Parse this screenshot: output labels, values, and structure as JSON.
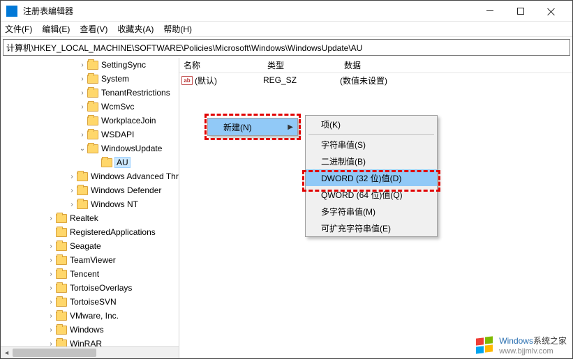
{
  "window": {
    "title": "注册表编辑器",
    "minimize": "—",
    "maximize": "□",
    "close": "×"
  },
  "menubar": [
    "文件(F)",
    "编辑(E)",
    "查看(V)",
    "收藏夹(A)",
    "帮助(H)"
  ],
  "address": "计算机\\HKEY_LOCAL_MACHINE\\SOFTWARE\\Policies\\Microsoft\\Windows\\WindowsUpdate\\AU",
  "columns": {
    "name": "名称",
    "type": "类型",
    "data": "数据"
  },
  "tree": [
    {
      "indent": 110,
      "chev": ">",
      "label": "SettingSync"
    },
    {
      "indent": 110,
      "chev": ">",
      "label": "System"
    },
    {
      "indent": 110,
      "chev": ">",
      "label": "TenantRestrictions"
    },
    {
      "indent": 110,
      "chev": ">",
      "label": "WcmSvc"
    },
    {
      "indent": 110,
      "chev": "",
      "label": "WorkplaceJoin"
    },
    {
      "indent": 110,
      "chev": ">",
      "label": "WSDAPI"
    },
    {
      "indent": 110,
      "chev": "v",
      "label": "WindowsUpdate"
    },
    {
      "indent": 130,
      "chev": "",
      "label": "AU",
      "highlight": true
    },
    {
      "indent": 95,
      "chev": ">",
      "label": "Windows Advanced Threat Protection"
    },
    {
      "indent": 95,
      "chev": ">",
      "label": "Windows Defender"
    },
    {
      "indent": 95,
      "chev": ">",
      "label": "Windows NT"
    },
    {
      "indent": 65,
      "chev": ">",
      "label": "Realtek"
    },
    {
      "indent": 65,
      "chev": "",
      "label": "RegisteredApplications"
    },
    {
      "indent": 65,
      "chev": ">",
      "label": "Seagate"
    },
    {
      "indent": 65,
      "chev": ">",
      "label": "TeamViewer"
    },
    {
      "indent": 65,
      "chev": ">",
      "label": "Tencent"
    },
    {
      "indent": 65,
      "chev": ">",
      "label": "TortoiseOverlays"
    },
    {
      "indent": 65,
      "chev": ">",
      "label": "TortoiseSVN"
    },
    {
      "indent": 65,
      "chev": ">",
      "label": "VMware, Inc."
    },
    {
      "indent": 65,
      "chev": ">",
      "label": "Windows"
    },
    {
      "indent": 65,
      "chev": ">",
      "label": "WinRAR"
    }
  ],
  "value": {
    "name": "(默认)",
    "type": "REG_SZ",
    "data": "(数值未设置)"
  },
  "ctx1": {
    "label": "新建(N)",
    "arrow": "▶"
  },
  "ctx2": {
    "items": [
      {
        "label": "项(K)"
      },
      {
        "sep": true
      },
      {
        "label": "字符串值(S)"
      },
      {
        "label": "二进制值(B)"
      },
      {
        "label": "DWORD (32 位)值(D)",
        "hover": true
      },
      {
        "label": "QWORD (64 位)值(Q)"
      },
      {
        "label": "多字符串值(M)"
      },
      {
        "label": "可扩充字符串值(E)"
      }
    ]
  },
  "watermark": {
    "brand": "Windows",
    "suffix": "系统之家",
    "url": "www.bjjmlv.com"
  }
}
